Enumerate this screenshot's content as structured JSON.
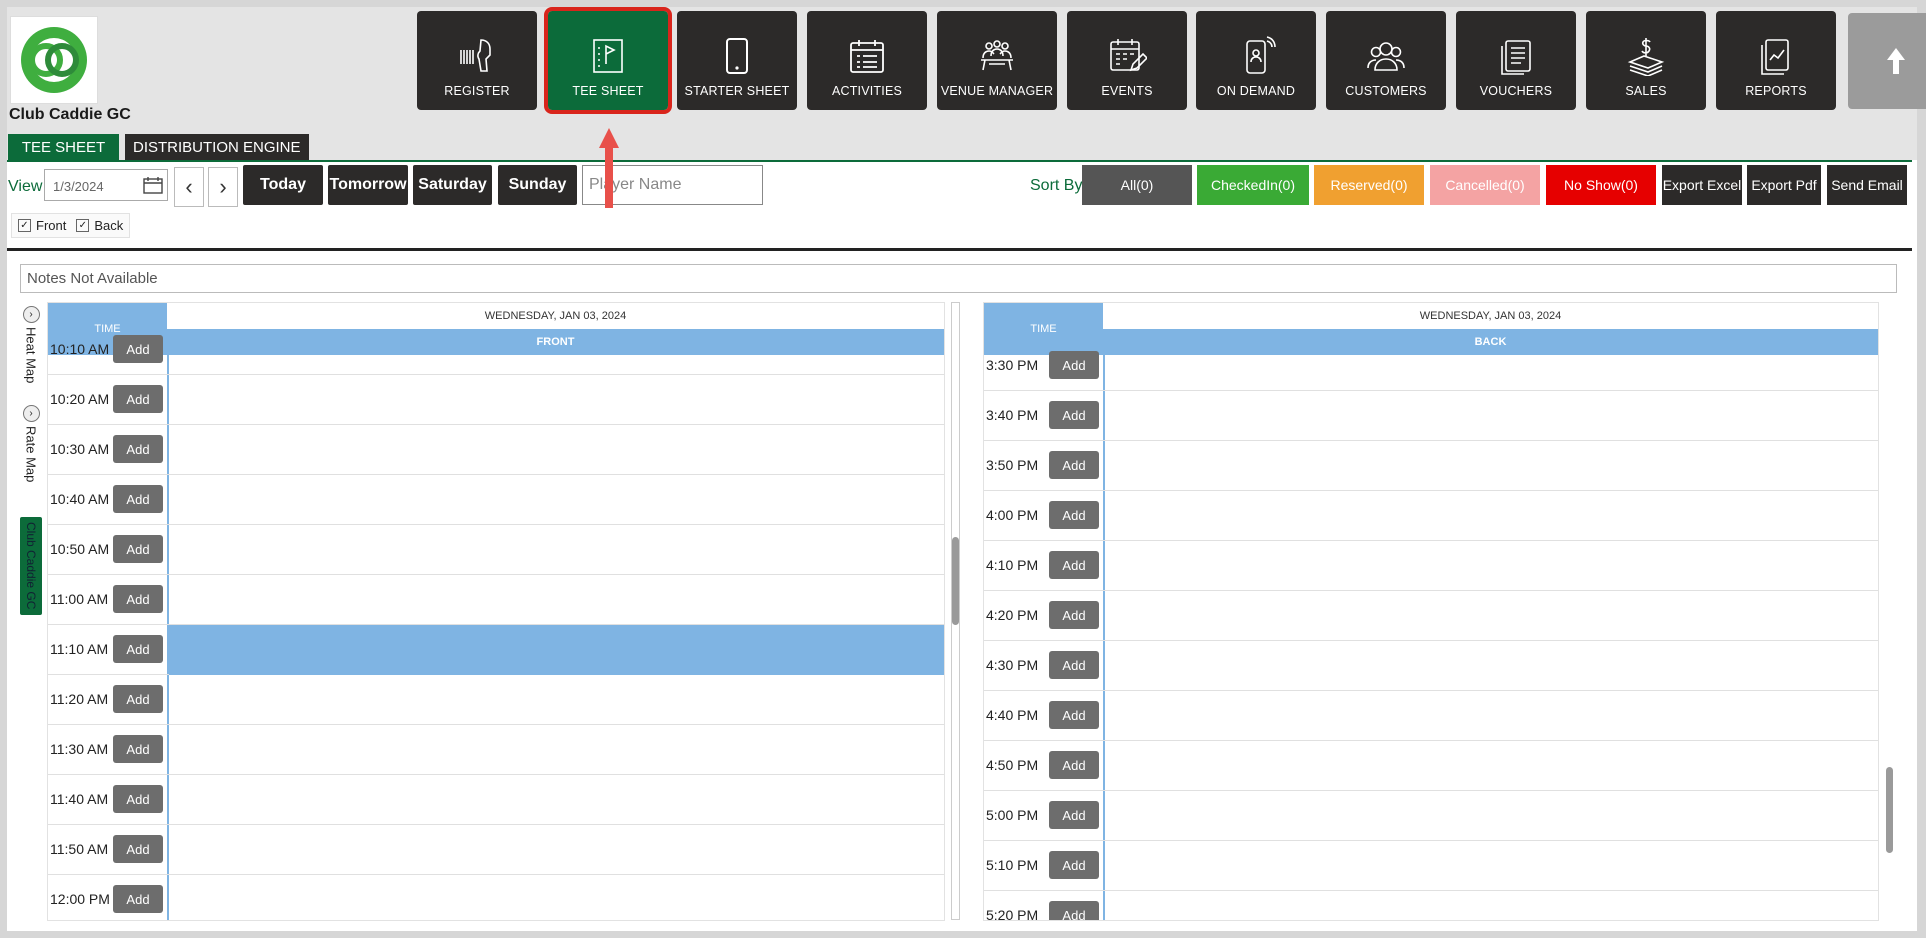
{
  "app": {
    "club_name": "Club Caddie GC",
    "logo_icon": "club-caddie-logo-icon"
  },
  "nav": [
    {
      "label": "REGISTER",
      "icon": "barcode-scanner-icon"
    },
    {
      "label": "TEE SHEET",
      "icon": "tee-sheet-icon",
      "active": true
    },
    {
      "label": "STARTER SHEET",
      "icon": "tablet-icon"
    },
    {
      "label": "ACTIVITIES",
      "icon": "calendar-list-icon"
    },
    {
      "label": "VENUE MANAGER",
      "icon": "meeting-table-icon"
    },
    {
      "label": "EVENTS",
      "icon": "calendar-edit-icon"
    },
    {
      "label": "ON DEMAND",
      "icon": "mobile-user-icon"
    },
    {
      "label": "CUSTOMERS",
      "icon": "users-icon"
    },
    {
      "label": "VOUCHERS",
      "icon": "voucher-icon"
    },
    {
      "label": "SALES",
      "icon": "money-stack-icon"
    },
    {
      "label": "REPORTS",
      "icon": "report-chart-icon"
    }
  ],
  "tabs": [
    "TEE SHEET",
    "DISTRIBUTION ENGINE"
  ],
  "toolbar": {
    "view_label": "View",
    "date_value": "1/3/2024",
    "day_buttons": [
      "Today",
      "Tomorrow",
      "Saturday",
      "Sunday"
    ],
    "player_placeholder": "Player Name",
    "sort_label": "Sort By",
    "filters": [
      {
        "label": "All(0)",
        "color": "#555555"
      },
      {
        "label": "CheckedIn(0)",
        "color": "#3aaa35"
      },
      {
        "label": "Reserved(0)",
        "color": "#f0a030"
      },
      {
        "label": "Cancelled(0)",
        "color": "#f4a3a3"
      },
      {
        "label": "No Show(0)",
        "color": "#e60000"
      }
    ],
    "exports": [
      "Export Excel",
      "Export Pdf",
      "Send Email"
    ]
  },
  "checkboxes": [
    {
      "label": "Front",
      "checked": true
    },
    {
      "label": "Back",
      "checked": true
    }
  ],
  "notes": "Notes Not Available",
  "side_tools": [
    "Heat Map",
    "Rate Map",
    "Club Caddie GC"
  ],
  "front": {
    "time_header": "TIME",
    "date": "WEDNESDAY, JAN 03, 2024",
    "course": "FRONT",
    "add_label": "Add",
    "partial_top_time": "10:10 AM",
    "times": [
      "10:20 AM",
      "10:30 AM",
      "10:40 AM",
      "10:50 AM",
      "11:00 AM",
      "11:10 AM",
      "11:20 AM",
      "11:30 AM",
      "11:40 AM",
      "11:50 AM",
      "12:00 PM"
    ],
    "highlighted_time": "11:10 AM"
  },
  "back": {
    "time_header": "TIME",
    "date": "WEDNESDAY, JAN 03, 2024",
    "course": "BACK",
    "add_label": "Add",
    "times": [
      "3:30 PM",
      "3:40 PM",
      "3:50 PM",
      "4:00 PM",
      "4:10 PM",
      "4:20 PM",
      "4:30 PM",
      "4:40 PM",
      "4:50 PM",
      "5:00 PM",
      "5:10 PM",
      "5:20 PM"
    ]
  }
}
